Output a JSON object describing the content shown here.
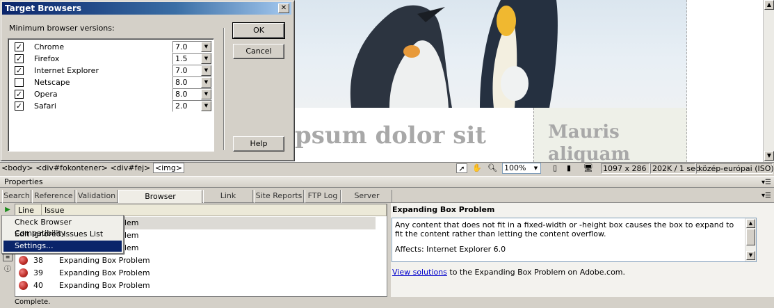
{
  "dialog": {
    "title": "Target Browsers",
    "close_glyph": "✕",
    "min_label": "Minimum browser versions:",
    "ok_label": "OK",
    "cancel_label": "Cancel",
    "help_label": "Help",
    "browsers": [
      {
        "name": "Chrome",
        "checked": true,
        "version": "7.0"
      },
      {
        "name": "Firefox",
        "checked": true,
        "version": "1.5"
      },
      {
        "name": "Internet Explorer",
        "checked": true,
        "version": "7.0"
      },
      {
        "name": "Netscape",
        "checked": false,
        "version": "8.0"
      },
      {
        "name": "Opera",
        "checked": true,
        "version": "8.0"
      },
      {
        "name": "Safari",
        "checked": true,
        "version": "2.0"
      }
    ]
  },
  "design": {
    "heading_fragment": "psum dolor sit",
    "side_heading_line1": "Mauris",
    "side_heading_line2": "aliquam"
  },
  "statusbar": {
    "tag_body": "<body>",
    "tag_div1": "<div#fokontener>",
    "tag_div2": "<div#fej>",
    "tag_current": "<img>",
    "zoom": "100%",
    "dimensions": "1097 x 286",
    "download": "202K / 1 sec",
    "encoding": "közép-európai (ISO)"
  },
  "properties_panel": {
    "title": "Properties"
  },
  "results_panel": {
    "tabs": [
      "Search",
      "Reference",
      "Validation",
      "Browser Compatibility",
      "Link Checker",
      "Site Reports",
      "FTP Log",
      "Server Debug"
    ],
    "active_tab": "Browser Compatibility",
    "col_line": "Line",
    "col_issue": "Issue",
    "rows": [
      {
        "line": "",
        "issue": "blem"
      },
      {
        "line": "",
        "issue": "blem"
      },
      {
        "line": "",
        "issue": "blem"
      },
      {
        "line": "38",
        "issue": "Expanding Box Problem"
      },
      {
        "line": "39",
        "issue": "Expanding Box Problem"
      },
      {
        "line": "40",
        "issue": "Expanding Box Problem"
      }
    ],
    "context_menu": [
      "Check Browser Compatibility",
      "Edit Ignored Issues List",
      "Settings..."
    ],
    "status": "Complete."
  },
  "detail": {
    "title": "Expanding Box Problem",
    "body_line1": "Any content that does not fit in a fixed-width or -height box causes the box to expand to fit the content rather than letting the content overflow.",
    "body_line2": "Affects: Internet Explorer 6.0",
    "link_text": "View solutions",
    "link_suffix": " to the Expanding Box Problem on Adobe.com."
  },
  "colors": {
    "title_bar": "#0a246a",
    "menu_highlight": "#0a246a",
    "link": "#0000cc"
  }
}
